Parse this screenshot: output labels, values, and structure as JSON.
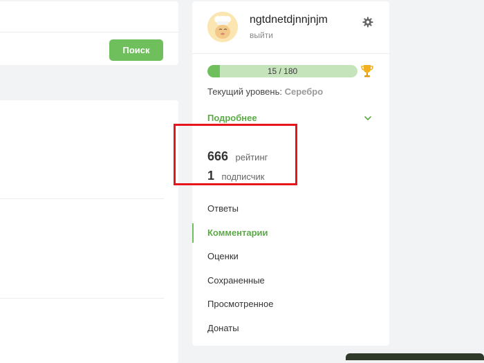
{
  "search": {
    "button_label": "Поиск"
  },
  "profile": {
    "username": "ngtdnetdjnnjnjm",
    "logout_label": "выйти",
    "progress": {
      "text": "15 / 180",
      "current": 15,
      "max": 180
    },
    "level_label": "Текущий уровень:",
    "level_value": "Серебро",
    "more_label": "Подробнее",
    "stats": {
      "rating_value": "666",
      "rating_label": "рейтинг",
      "subscribers_value": "1",
      "subscribers_label": "подписчик"
    },
    "menu": [
      {
        "label": "Ответы",
        "active": false
      },
      {
        "label": "Комментарии",
        "active": true
      },
      {
        "label": "Оценки",
        "active": false
      },
      {
        "label": "Сохраненные",
        "active": false
      },
      {
        "label": "Просмотренное",
        "active": false
      },
      {
        "label": "Донаты",
        "active": false
      }
    ]
  },
  "colors": {
    "accent": "#6fbf5c",
    "accent_text": "#5aab45",
    "progress_track": "#c6e4bb",
    "highlight": "#e8141b"
  },
  "icons": {
    "settings": "gear-icon",
    "trophy": "trophy-icon",
    "expand": "chevron-down-icon",
    "avatar": "chef-avatar"
  }
}
